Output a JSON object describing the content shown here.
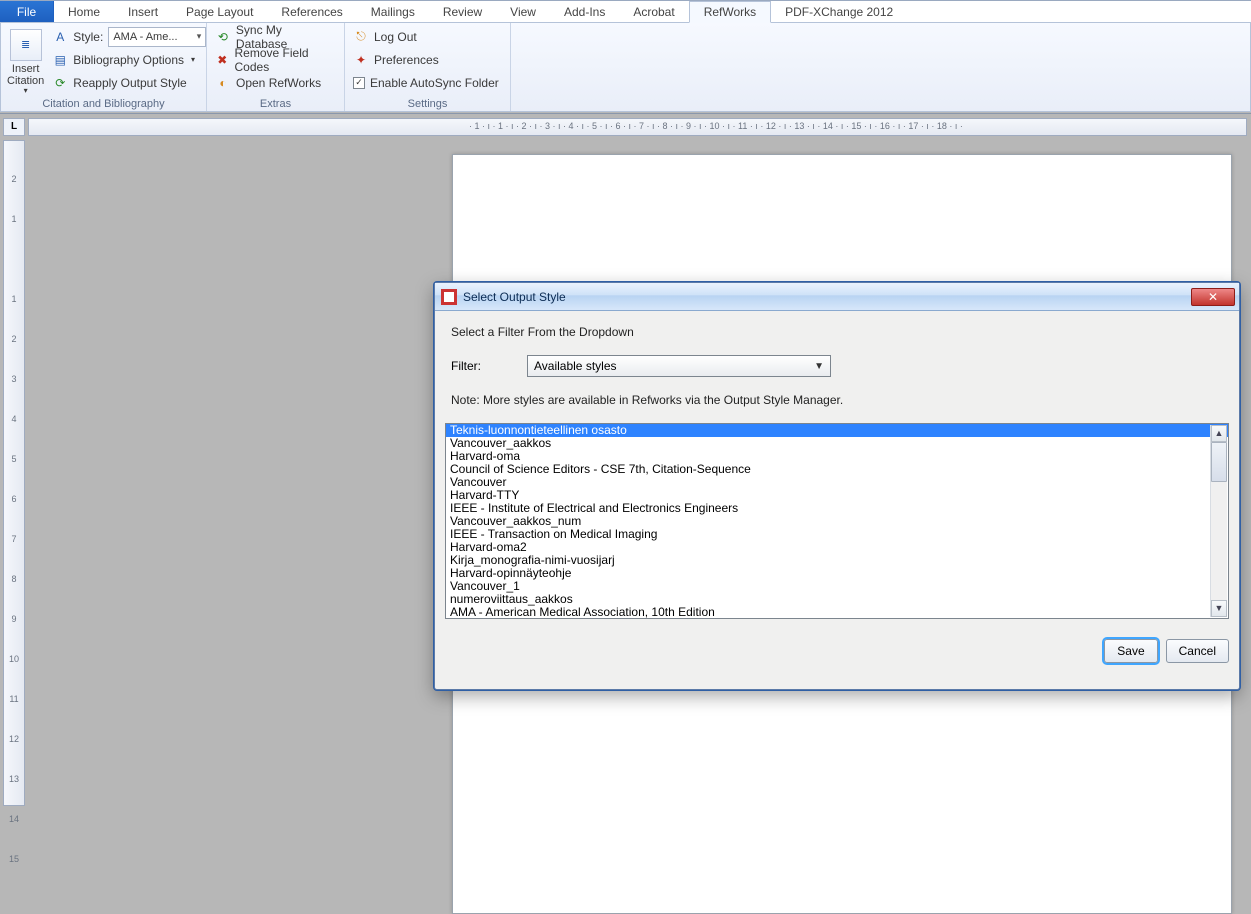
{
  "tabs": {
    "file": "File",
    "items": [
      "Home",
      "Insert",
      "Page Layout",
      "References",
      "Mailings",
      "Review",
      "View",
      "Add-Ins",
      "Acrobat",
      "RefWorks",
      "PDF-XChange 2012"
    ],
    "active": "RefWorks"
  },
  "ribbon": {
    "group1": {
      "label": "Citation and Bibliography",
      "insert_citation": "Insert Citation",
      "style_label": "Style:",
      "style_value": "AMA - Ame...",
      "bib_options": "Bibliography Options",
      "reapply": "Reapply Output Style"
    },
    "group2": {
      "label": "Extras",
      "sync": "Sync My Database",
      "remove": "Remove Field Codes",
      "open": "Open RefWorks"
    },
    "group3": {
      "label": "Settings",
      "logout": "Log Out",
      "prefs": "Preferences",
      "autosync": "Enable AutoSync Folder"
    }
  },
  "ruler": {
    "corner": "L",
    "horizontal": "· 1 · ı · 1 · ı · 2 · ı · 3 · ı · 4 · ı · 5 · ı · 6 · ı · 7 · ı · 8 · ı · 9 · ı · 10 · ı · 11 · ı · 12 · ı · 13 · ı · 14 · ı · 15 · ı · 16 · ı · 17 · ı · 18 · ı ·",
    "vertical": [
      "2",
      "1",
      "",
      "1",
      "2",
      "3",
      "4",
      "5",
      "6",
      "7",
      "8",
      "9",
      "10",
      "11",
      "12",
      "13",
      "14",
      "15"
    ]
  },
  "dialog": {
    "title": "Select Output Style",
    "header": "Select a Filter From the Dropdown",
    "filter_label": "Filter:",
    "filter_value": "Available styles",
    "note": "Note: More styles are available in Refworks via the Output Style Manager.",
    "items": [
      "Teknis-luonnontieteellinen osasto",
      "Vancouver_aakkos",
      "Harvard-oma",
      "Council of Science Editors - CSE 7th, Citation-Sequence",
      "Vancouver",
      "Harvard-TTY",
      "IEEE - Institute of Electrical and Electronics Engineers",
      "Vancouver_aakkos_num",
      "IEEE - Transaction on Medical Imaging",
      "Harvard-oma2",
      "Kirja_monografia-nimi-vuosijarj",
      "Harvard-opinnäyteohje",
      "Vancouver_1",
      "numeroviittaus_aakkos",
      "AMA - American Medical Association, 10th Edition"
    ],
    "selected_index": 0,
    "save": "Save",
    "cancel": "Cancel",
    "close_glyph": "✕"
  }
}
